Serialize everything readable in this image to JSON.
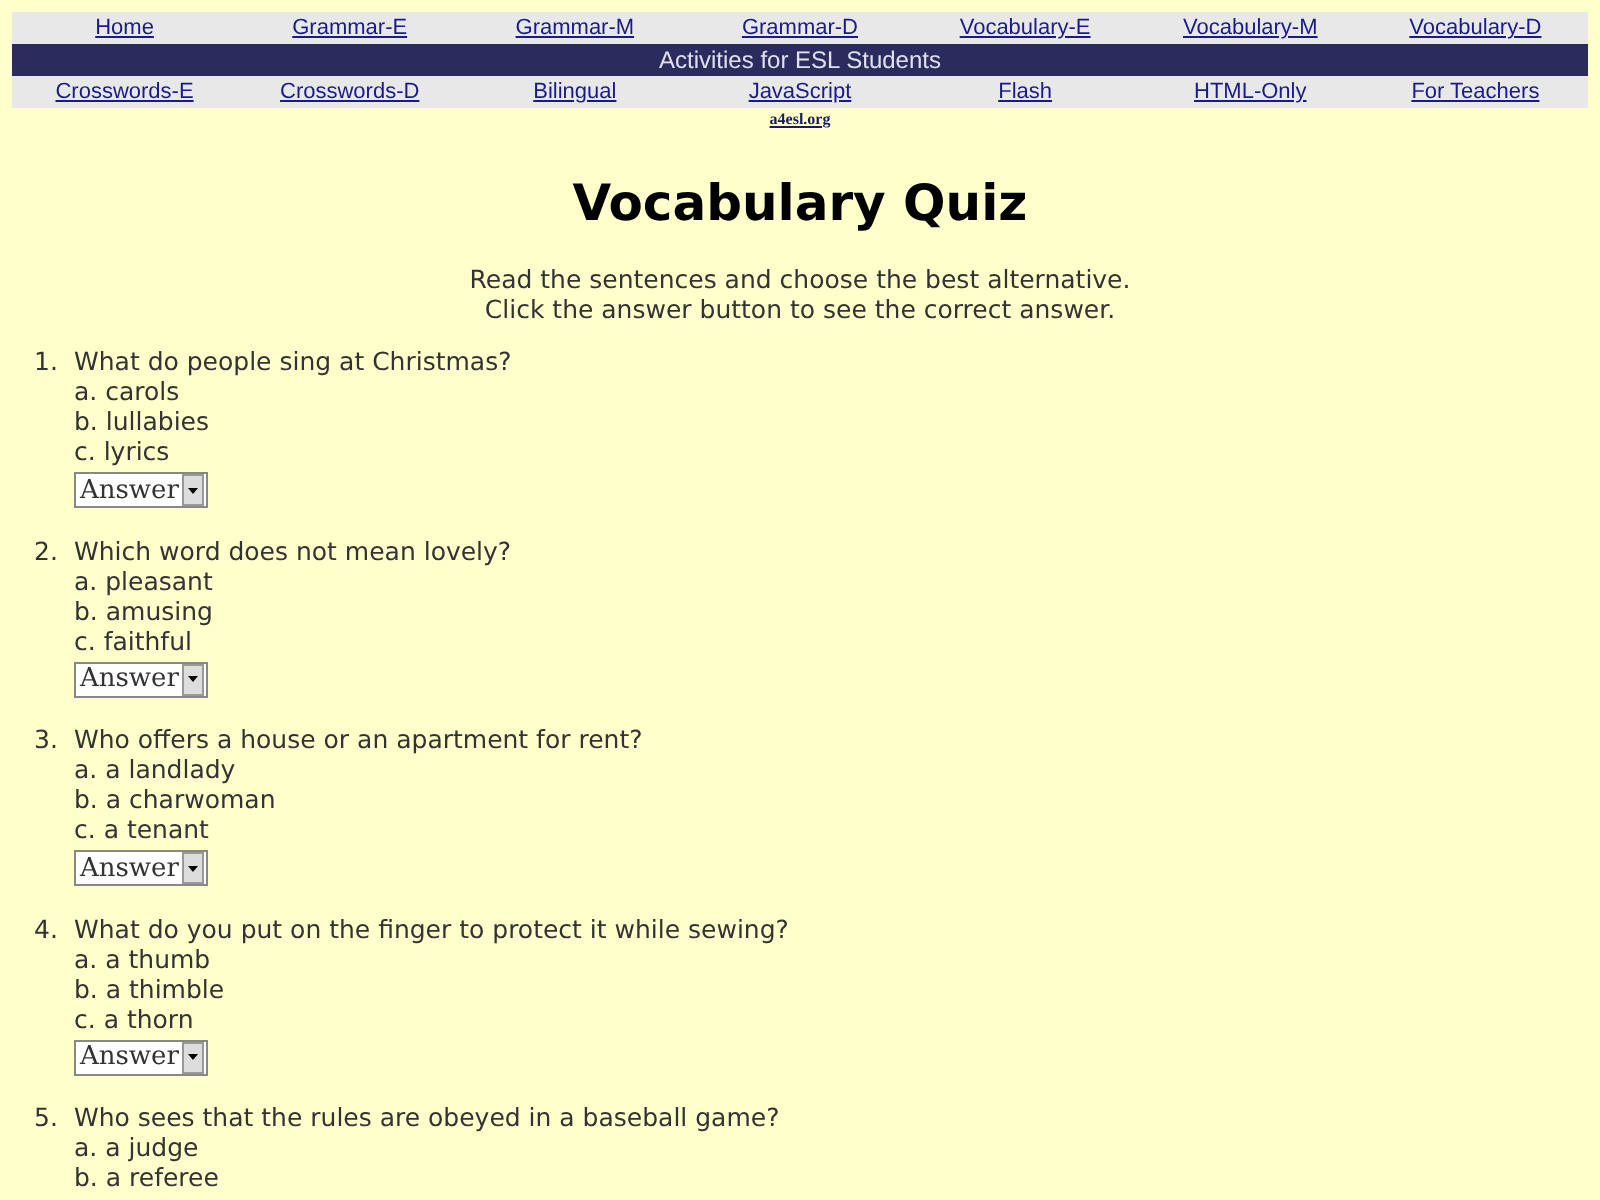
{
  "nav_top": [
    "Home",
    "Grammar-E",
    "Grammar-M",
    "Grammar-D",
    "Vocabulary-E",
    "Vocabulary-M",
    "Vocabulary-D"
  ],
  "banner": "Activities for ESL Students",
  "nav_bottom": [
    "Crosswords-E",
    "Crosswords-D",
    "Bilingual",
    "JavaScript",
    "Flash",
    "HTML-Only",
    "For Teachers"
  ],
  "site_link": "a4esl.org",
  "title": "Vocabulary Quiz",
  "instructions": [
    "Read the sentences and choose the best alternative.",
    "Click the answer button to see the correct answer."
  ],
  "questions": [
    {
      "number": "1.",
      "text": "What do people sing at Christmas?",
      "options": [
        "a. carols",
        "b. lullabies",
        "c. lyrics"
      ],
      "answer_button": "Answer"
    },
    {
      "number": "2.",
      "text": "Which word does not mean lovely?",
      "options": [
        "a. pleasant",
        "b. amusing",
        "c. faithful"
      ],
      "answer_button": "Answer"
    },
    {
      "number": "3.",
      "text": "Who offers a house or an apartment for rent?",
      "options": [
        "a. a landlady",
        "b. a charwoman",
        "c. a tenant"
      ],
      "answer_button": "Answer"
    },
    {
      "number": "4.",
      "text": "What do you put on the finger to protect it while sewing?",
      "options": [
        "a. a thumb",
        "b. a thimble",
        "c. a thorn"
      ],
      "answer_button": "Answer"
    },
    {
      "number": "5.",
      "text": "Who sees that the rules are obeyed in a baseball game?",
      "options": [
        "a. a judge",
        "b. a referee"
      ]
    }
  ]
}
